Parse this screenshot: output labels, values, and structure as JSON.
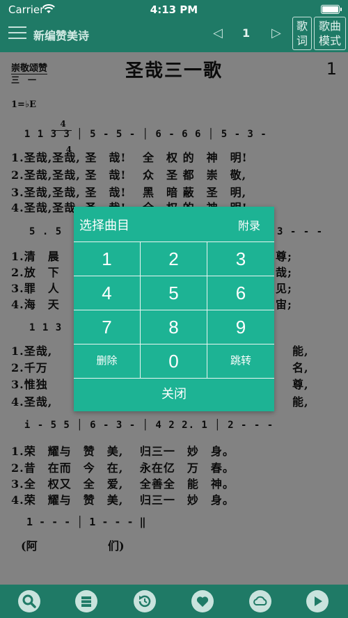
{
  "status": {
    "carrier": "Carrier",
    "time": "4:13 PM"
  },
  "nav": {
    "title": "新编赞美诗",
    "page": "1",
    "lyrics_button": [
      "歌",
      "词"
    ],
    "mode_button": [
      "歌曲",
      "模式"
    ]
  },
  "score": {
    "category": "崇敬颂赞",
    "category_sub": "三　一",
    "title": "圣哉三一歌",
    "number": "1",
    "key": "1=♭E",
    "time_top": "4",
    "time_bottom": "4",
    "rows": [
      {
        "notes": "  1 1 3 3 │ 5 - 5 - │ 6 - 6 6 │ 5 - 3 -",
        "lyrics": [
          "1.圣哉,圣哉, 圣　哉!　 全　权 的　神　明!",
          "2.圣哉,圣哉, 圣　哉!　 众　圣 都　崇　敬,",
          "3.圣哉,圣哉, 圣　哉!　 黑　暗 蔽　圣　明,",
          "4.圣哉,圣哉, 圣　哉!　 全　权 的　神　明!"
        ]
      },
      {
        "notes": "5 . 5",
        "notes_right": "3 - - -",
        "lyrics": [
          "1.清　晨",
          "2.放　下",
          "3.罪　人",
          "4.海　天"
        ],
        "lyrics_right": [
          "尊;",
          "哉;",
          "见;",
          "宙;"
        ]
      },
      {
        "notes": "1 1 3",
        "lyrics": [
          "1.圣哉,",
          "2.千万",
          "3.惟独",
          "4.圣哉,"
        ],
        "lyrics_right": [
          "能,",
          "名,",
          "尊,",
          "能,"
        ]
      },
      {
        "notes": "  i - 5 5 │ 6 - 3 - │ 4 2 2. 1 │ 2 - - -",
        "lyrics": [
          "1.荣　耀与　赞　美,　 归三一　妙　身。",
          "2.昔　在而　今　在,　 永在亿　万　春。",
          "3.全　权又　全　爱,　 全善全　能　神。",
          "4.荣　耀与　赞　美,　 归三一　妙　身。"
        ]
      }
    ],
    "amen_notes": "1 - - - │ 1 - - - ‖",
    "amen_a": "(阿",
    "amen_b": "们)"
  },
  "dialog": {
    "title": "选择曲目",
    "appendix": "附录",
    "keys": [
      "1",
      "2",
      "3",
      "4",
      "5",
      "6",
      "7",
      "8",
      "9",
      "删除",
      "0",
      "跳转"
    ],
    "close": "关闭"
  },
  "toolbar": {
    "icons": [
      "search-icon",
      "list-icon",
      "history-icon",
      "favorite-icon",
      "cloud-icon",
      "play-icon"
    ]
  },
  "colors": {
    "nav": "#1f7a66",
    "dialog": "#1db394",
    "overlay_page": "#828282"
  }
}
